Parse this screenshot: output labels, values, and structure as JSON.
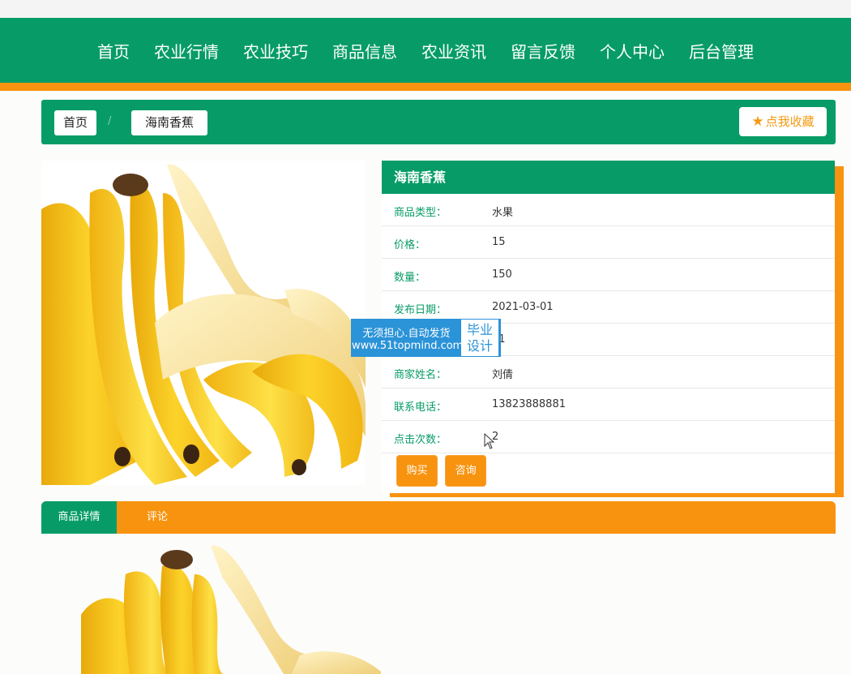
{
  "nav": {
    "items": [
      "首页",
      "农业行情",
      "农业技巧",
      "商品信息",
      "农业资讯",
      "留言反馈",
      "个人中心",
      "后台管理"
    ]
  },
  "breadcrumb": {
    "home": "首页",
    "separator": "/",
    "current": "海南香蕉"
  },
  "favorite_button": {
    "icon": "star-icon",
    "label": "点我收藏"
  },
  "product": {
    "title": "海南香蕉",
    "fields": [
      {
        "label": "商品类型：",
        "value": "水果"
      },
      {
        "label": "价格：",
        "value": "15"
      },
      {
        "label": "数量：",
        "value": "150"
      },
      {
        "label": "发布日期：",
        "value": "2021-03-01"
      },
      {
        "label": "",
        "value": "01"
      },
      {
        "label": "商家姓名：",
        "value": "刘倩"
      },
      {
        "label": "联系电话：",
        "value": "13823888881"
      },
      {
        "label": "点击次数：",
        "value": "2"
      }
    ],
    "buttons": {
      "buy": "购买",
      "consult": "咨询"
    }
  },
  "watermark": {
    "line1": "无须担心.自动发货",
    "line2": "www.51topmind.com",
    "right1": "毕业",
    "right2": "设计"
  },
  "tabs": {
    "detail": "商品详情",
    "comment": "评论"
  },
  "colors": {
    "primary_green": "#079c67",
    "accent_orange": "#f8930f",
    "watermark_blue": "#2b93d8"
  }
}
